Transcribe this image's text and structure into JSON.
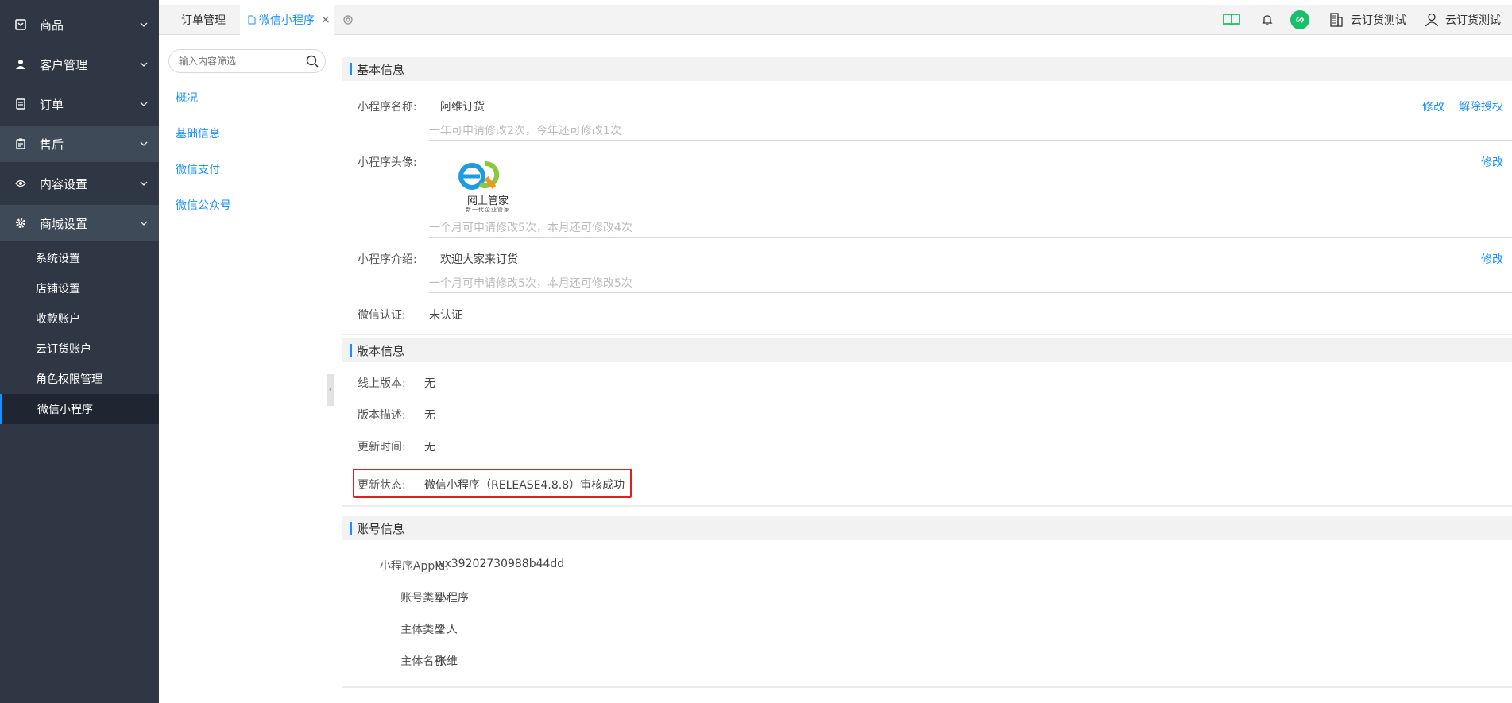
{
  "sidebar": {
    "menus": [
      {
        "label": "商品",
        "icon": "product-icon"
      },
      {
        "label": "客户管理",
        "icon": "customer-icon"
      },
      {
        "label": "订单",
        "icon": "order-icon"
      },
      {
        "label": "售后",
        "icon": "after-sales-icon"
      },
      {
        "label": "内容设置",
        "icon": "eye-icon"
      },
      {
        "label": "商城设置",
        "icon": "gear-icon"
      }
    ],
    "submenu": [
      "系统设置",
      "店铺设置",
      "收款账户",
      "云订货账户",
      "角色权限管理",
      "微信小程序"
    ]
  },
  "header": {
    "tabs": [
      {
        "label": "订单管理"
      },
      {
        "label": "微信小程序",
        "close": "×"
      }
    ],
    "company": "云订货测试",
    "user": "云订货测试",
    "colors": {
      "accent": "#1890ff",
      "book_green": "#19be6b",
      "link_badge_green": "#19be6b"
    }
  },
  "subnav": {
    "search_placeholder": "输入内容筛选",
    "links": [
      "概况",
      "基础信息",
      "微信支付",
      "微信公众号"
    ]
  },
  "basic_info": {
    "title": "基本信息",
    "name_label": "小程序名称:",
    "name_value": "阿维订货",
    "name_hint": "一年可申请修改2次，今年还可修改1次",
    "edit": "修改",
    "unbind": "解除授权",
    "avatar_label": "小程序头像:",
    "avatar_hint": "一个月可申请修改5次，本月还可修改4次",
    "logo_text": "网上管家",
    "logo_subtext": "新一代企业管家",
    "intro_label": "小程序介绍:",
    "intro_value": "欢迎大家来订货",
    "intro_hint": "一个月可申请修改5次，本月还可修改5次",
    "verify_label": "微信认证:",
    "verify_value": "未认证"
  },
  "version_info": {
    "title": "版本信息",
    "online_label": "线上版本:",
    "online_value": "无",
    "desc_label": "版本描述:",
    "desc_value": "无",
    "time_label": "更新时间:",
    "time_value": "无",
    "status_label": "更新状态:",
    "status_value": "微信小程序（RELEASE4.8.8）审核成功",
    "highlight_color": "#e02020"
  },
  "account_info": {
    "title": "账号信息",
    "appid_label": "小程序AppId:",
    "appid_value": "wx39202730988b44dd",
    "type_label": "账号类型:",
    "type_value": "小程序",
    "subject_type_label": "主体类型:",
    "subject_type_value": "个人",
    "subject_name_label": "主体名称:",
    "subject_name_value": "张维"
  }
}
